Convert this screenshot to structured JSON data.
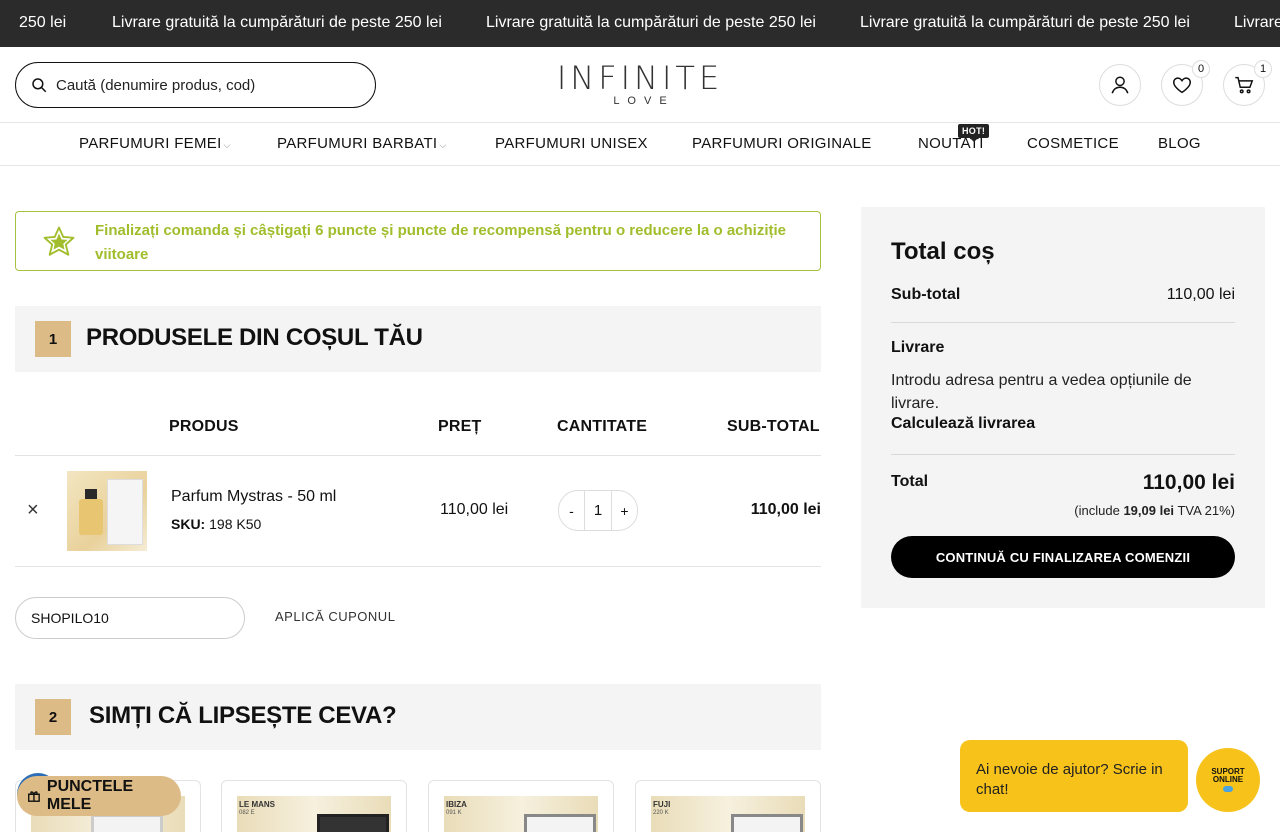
{
  "topbar": {
    "messages": [
      "250 lei",
      "Livrare gratuită la cumpărături de peste 250 lei",
      "Livrare gratuită la cumpărături de peste 250 lei",
      "Livrare gratuită la cumpărături de peste 250 lei",
      "Livrare"
    ]
  },
  "header": {
    "search_placeholder": "Caută (denumire produs, cod)",
    "logo_main": "INFINITE",
    "logo_sub": "LOVE",
    "wishlist_count": "0",
    "cart_count": "1",
    "icons": [
      "search-icon",
      "user-icon",
      "heart-icon",
      "cart-icon"
    ]
  },
  "nav": {
    "items": [
      {
        "label": "PARFUMURI FEMEI",
        "has_dropdown": true
      },
      {
        "label": "PARFUMURI BARBATI",
        "has_dropdown": true
      },
      {
        "label": "PARFUMURI UNISEX",
        "has_dropdown": false
      },
      {
        "label": "PARFUMURI ORIGINALE",
        "has_dropdown": false
      },
      {
        "label": "NOUTATI",
        "has_dropdown": false,
        "badge": "HOT!"
      },
      {
        "label": "COSMETICE",
        "has_dropdown": false
      },
      {
        "label": "BLOG",
        "has_dropdown": false
      }
    ]
  },
  "reward": {
    "text": "Finalizați comanda și câștigați 6 puncte și puncte de recompensă pentru o reducere la o achiziție viitoare",
    "color": "#a0bd2b"
  },
  "cart_section": {
    "number": "1",
    "title": "PRODUSELE DIN COȘUL TĂU",
    "columns": [
      "PRODUS",
      "PREȚ",
      "CANTITATE",
      "SUB-TOTAL"
    ],
    "items": [
      {
        "remove_label": "×",
        "name": "Parfum Mystras - 50 ml",
        "sku_label": "SKU:",
        "sku": "198 K50",
        "price": "110,00 lei",
        "qty_minus": "-",
        "qty": "1",
        "qty_plus": "+",
        "subtotal": "110,00 lei"
      }
    ],
    "coupon_value": "SHOPILO10",
    "apply_label": "APLICĂ CUPONUL"
  },
  "suggest_section": {
    "number": "2",
    "title": "SIMȚI CĂ LIPSEȘTE CEVA?",
    "cards": [
      {
        "name": "",
        "sub": ""
      },
      {
        "name": "LE MANS",
        "sub": "082 E"
      },
      {
        "name": "IBIZA",
        "sub": "091 K"
      },
      {
        "name": "FUJI",
        "sub": "220 K"
      }
    ]
  },
  "summary": {
    "title": "Total coș",
    "subtotal_label": "Sub-total",
    "subtotal_value": "110,00 lei",
    "shipping_label": "Livrare",
    "shipping_info": "Introdu adresa pentru a vedea opțiunile de livrare.",
    "calc_shipping": "Calculează livrarea",
    "total_label": "Total",
    "total_value": "110,00 lei",
    "vat_prefix": "(include",
    "vat_amount": "19,09 lei",
    "vat_suffix": "TVA 21%)",
    "checkout_label": "CONTINUĂ CU FINALIZAREA COMENZII"
  },
  "chat": {
    "bubble": "Ai nevoie de ajutor? Scrie in chat!",
    "button_line1": "SUPORT",
    "button_line2": "ONLINE"
  },
  "points": {
    "label": "PUNCTELE MELE"
  }
}
